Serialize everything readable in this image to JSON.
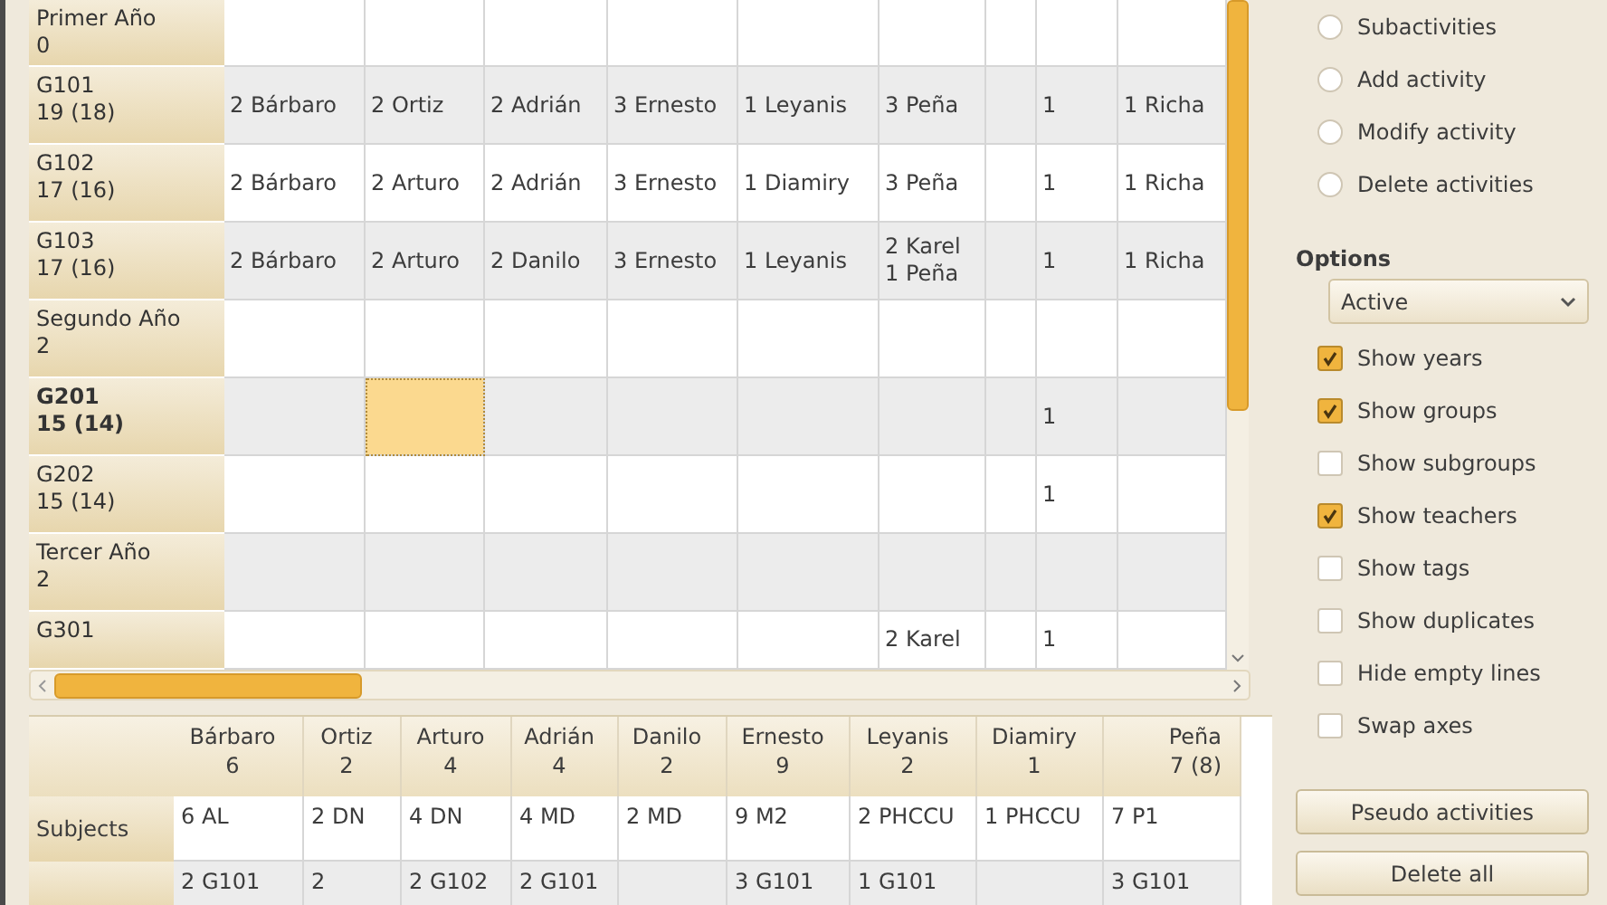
{
  "activity_grid": {
    "rows": [
      {
        "label": "Primer Año\n0",
        "selected": false,
        "cells": [
          {
            "selected": false
          },
          {
            "selected": false
          },
          {
            "selected": false
          },
          {
            "selected": false
          },
          {
            "selected": false
          },
          {
            "selected": false
          },
          {
            "selected": false
          },
          {
            "selected": false
          },
          {
            "selected": false
          }
        ]
      },
      {
        "label": "G101\n19 (18)",
        "selected": false,
        "cells": [
          {
            "text": "2 Bárbaro",
            "selected": false
          },
          {
            "text": "2 Ortiz",
            "selected": false
          },
          {
            "text": "2 Adrián",
            "selected": false
          },
          {
            "text": "3 Ernesto",
            "selected": false
          },
          {
            "text": "1 Leyanis",
            "selected": false
          },
          {
            "text": "3 Peña",
            "selected": false
          },
          {
            "selected": false
          },
          {
            "text": "1",
            "selected": false
          },
          {
            "text": "1 Richa",
            "selected": false
          }
        ]
      },
      {
        "label": "G102\n17 (16)",
        "selected": false,
        "cells": [
          {
            "text": "2 Bárbaro",
            "selected": false
          },
          {
            "text": "2 Arturo",
            "selected": false
          },
          {
            "text": "2 Adrián",
            "selected": false
          },
          {
            "text": "3 Ernesto",
            "selected": false
          },
          {
            "text": "1 Diamiry",
            "selected": false
          },
          {
            "text": "3 Peña",
            "selected": false
          },
          {
            "selected": false
          },
          {
            "text": "1",
            "selected": false
          },
          {
            "text": "1 Richa",
            "selected": false
          }
        ]
      },
      {
        "label": "G103\n17 (16)",
        "selected": false,
        "cells": [
          {
            "text": "2 Bárbaro",
            "selected": false
          },
          {
            "text": "2 Arturo",
            "selected": false
          },
          {
            "text": "2 Danilo",
            "selected": false
          },
          {
            "text": "3 Ernesto",
            "selected": false
          },
          {
            "text": "1 Leyanis",
            "selected": false
          },
          {
            "text": "2 Karel\n1 Peña",
            "selected": false
          },
          {
            "selected": false
          },
          {
            "text": "1",
            "selected": false
          },
          {
            "text": "1 Richa",
            "selected": false
          }
        ]
      },
      {
        "label": "Segundo Año\n2",
        "selected": false,
        "cells": [
          {
            "selected": false
          },
          {
            "selected": false
          },
          {
            "selected": false
          },
          {
            "selected": false
          },
          {
            "selected": false
          },
          {
            "selected": false
          },
          {
            "selected": false
          },
          {
            "selected": false
          },
          {
            "selected": false
          }
        ]
      },
      {
        "label": "G201\n15 (14)",
        "selected": true,
        "cells": [
          {
            "selected": false
          },
          {
            "selected": true
          },
          {
            "selected": false
          },
          {
            "selected": false
          },
          {
            "selected": false
          },
          {
            "selected": false
          },
          {
            "selected": false
          },
          {
            "text": "1",
            "selected": false
          },
          {
            "selected": false
          }
        ]
      },
      {
        "label": "G202\n15 (14)",
        "selected": false,
        "cells": [
          {
            "selected": false
          },
          {
            "selected": false
          },
          {
            "selected": false
          },
          {
            "selected": false
          },
          {
            "selected": false
          },
          {
            "selected": false
          },
          {
            "selected": false
          },
          {
            "text": "1",
            "selected": false
          },
          {
            "selected": false
          }
        ]
      },
      {
        "label": "Tercer Año\n2",
        "selected": false,
        "cells": [
          {
            "selected": false
          },
          {
            "selected": false
          },
          {
            "selected": false
          },
          {
            "selected": false
          },
          {
            "selected": false
          },
          {
            "selected": false
          },
          {
            "selected": false
          },
          {
            "selected": false
          },
          {
            "selected": false
          }
        ]
      },
      {
        "label": "G301",
        "selected": false,
        "cells": [
          {
            "selected": false
          },
          {
            "selected": false
          },
          {
            "selected": false
          },
          {
            "selected": false
          },
          {
            "selected": false
          },
          {
            "text": "2 Karel",
            "selected": false
          },
          {
            "selected": false
          },
          {
            "text": "1",
            "selected": false
          },
          {
            "selected": false
          }
        ]
      }
    ]
  },
  "summary_table": {
    "columns": [
      "Bárbaro\n6",
      "Ortiz\n2",
      "Arturo\n4",
      "Adrián\n4",
      "Danilo\n2",
      "Ernesto\n9",
      "Leyanis\n2",
      "Diamiry\n1",
      "Peña\n7 (8)"
    ],
    "rows": [
      {
        "label": "Subjects",
        "cells": [
          "6 AL",
          "2 DN",
          "4 DN",
          "4 MD",
          "2 MD",
          "9 M2",
          "2 PHCCU",
          "1 PHCCU",
          "7 P1"
        ]
      },
      {
        "cells": [
          "2 G101",
          "2",
          "2 G102",
          "2 G101",
          null,
          "3 G101",
          "1 G101",
          null,
          "3 G101"
        ]
      }
    ]
  },
  "side_panel": {
    "modes": [
      {
        "label": "Subactivities",
        "selected": false
      },
      {
        "label": "Add activity",
        "selected": false
      },
      {
        "label": "Modify activity",
        "selected": false
      },
      {
        "label": "Delete activities",
        "selected": false
      }
    ],
    "options_heading": "Options",
    "filter": {
      "value": "Active"
    },
    "options": [
      {
        "label": "Show years",
        "checked": true
      },
      {
        "label": "Show groups",
        "checked": true
      },
      {
        "label": "Show subgroups",
        "checked": false
      },
      {
        "label": "Show teachers",
        "checked": true
      },
      {
        "label": "Show tags",
        "checked": false
      },
      {
        "label": "Show duplicates",
        "checked": false
      },
      {
        "label": "Hide empty lines",
        "checked": false
      },
      {
        "label": "Swap axes",
        "checked": false
      }
    ],
    "buttons": [
      "Pseudo activities",
      "Delete all"
    ]
  }
}
